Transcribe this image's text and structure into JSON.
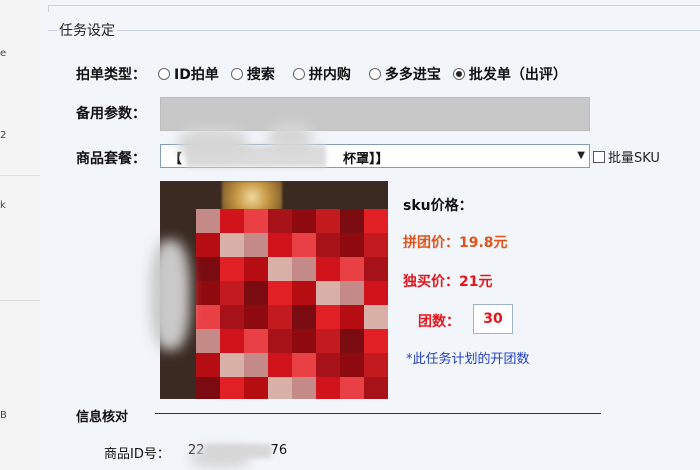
{
  "section": {
    "title": "任务设定"
  },
  "task_type": {
    "label": "拍单类型：",
    "options": [
      {
        "label": "ID拍单",
        "selected": false
      },
      {
        "label": "搜索",
        "selected": false
      },
      {
        "label": "拼内购",
        "selected": false
      },
      {
        "label": "多多进宝",
        "selected": false
      },
      {
        "label": "批发单（出评）",
        "selected": true
      }
    ]
  },
  "backup_params": {
    "label": "备用参数：",
    "value": ""
  },
  "product_package": {
    "label": "商品套餐：",
    "selected_prefix": "【",
    "selected_suffix": "杯罩】】",
    "batch_sku_label": "批量SKU",
    "batch_sku_checked": false
  },
  "sku": {
    "title": "sku价格：",
    "group_price_label": "拼团价：",
    "group_price_value": "19.8元",
    "solo_price_label": "独买价：",
    "solo_price_value": "21元",
    "group_count_label": "团数：",
    "group_count_value": "30",
    "hint": "*此任务计划的开团数"
  },
  "info": {
    "title": "信息核对",
    "product_id_label": "商品ID号：",
    "product_id_start": "22",
    "product_id_end": "76"
  },
  "colors": {
    "orange": "#e0531a",
    "red": "#e6151c",
    "blue": "#2340c8"
  }
}
